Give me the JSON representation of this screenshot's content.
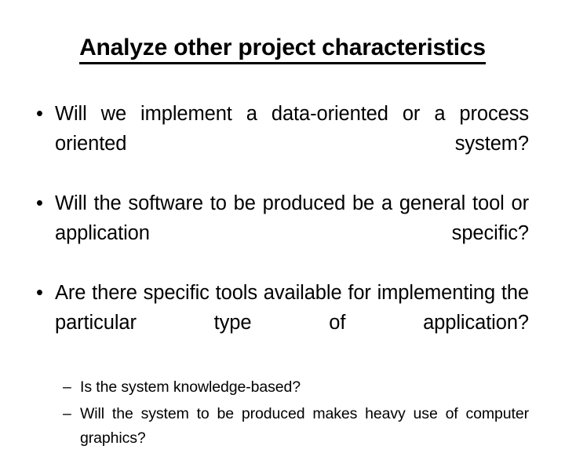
{
  "slide": {
    "title": "Analyze other project characteristics",
    "bullet_marker": "•",
    "sub_bullet_marker": "–",
    "background_color": "#ffffff",
    "text_color": "#000000",
    "bullets": [
      {
        "text": "Will we implement a data-oriented or a process oriented system?"
      },
      {
        "text": "Will the software to be produced be a general tool or application specific?"
      },
      {
        "text": "Are there specific tools available for implementing the particular type of application?"
      }
    ],
    "sub_bullets": [
      {
        "text": "Is the system knowledge-based?"
      },
      {
        "text": "Will the system to be produced makes heavy use of computer graphics?"
      }
    ]
  }
}
